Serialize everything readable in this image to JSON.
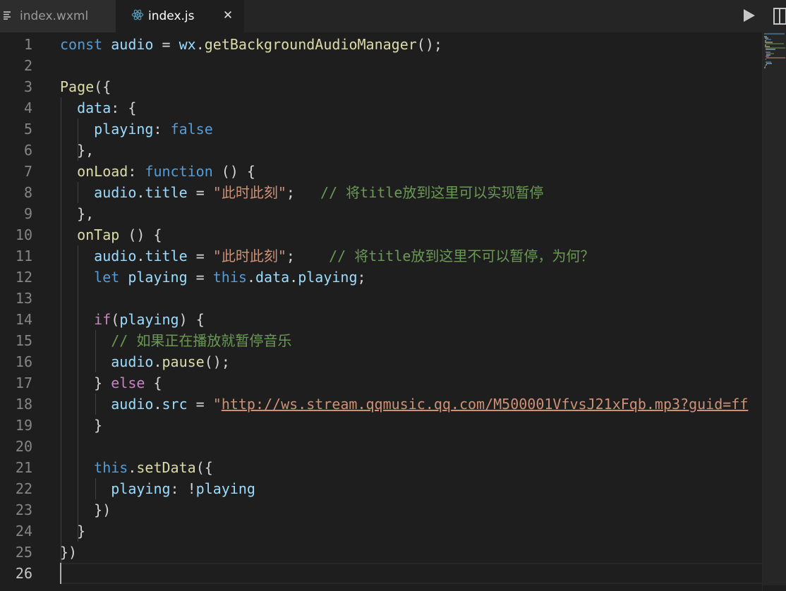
{
  "tabs": [
    {
      "label": "index.wxml",
      "icon": "file-lines-icon",
      "active": false
    },
    {
      "label": "index.js",
      "icon": "react-atom-icon",
      "active": true,
      "close": "✕"
    }
  ],
  "toolbar": {
    "run_icon": "play-icon",
    "split_icon": "split-editor-icon"
  },
  "editor": {
    "current_line": 26,
    "lines": [
      {
        "n": "1",
        "t": [
          [
            "kw",
            "const"
          ],
          [
            "pn",
            " "
          ],
          [
            "var",
            "audio"
          ],
          [
            "pn",
            " = "
          ],
          [
            "var",
            "wx"
          ],
          [
            "pn",
            "."
          ],
          [
            "fn",
            "getBackgroundAudioManager"
          ],
          [
            "pn",
            "();"
          ]
        ]
      },
      {
        "n": "2",
        "t": []
      },
      {
        "n": "3",
        "t": [
          [
            "fn",
            "Page"
          ],
          [
            "pn",
            "({"
          ]
        ]
      },
      {
        "n": "4",
        "t": [
          [
            "pn",
            "  "
          ],
          [
            "var",
            "data"
          ],
          [
            "pn",
            ": {"
          ]
        ]
      },
      {
        "n": "5",
        "t": [
          [
            "pn",
            "    "
          ],
          [
            "var",
            "playing"
          ],
          [
            "pn",
            ": "
          ],
          [
            "kw",
            "false"
          ]
        ]
      },
      {
        "n": "6",
        "t": [
          [
            "pn",
            "  },"
          ]
        ]
      },
      {
        "n": "7",
        "t": [
          [
            "pn",
            "  "
          ],
          [
            "fn",
            "onLoad"
          ],
          [
            "pn",
            ": "
          ],
          [
            "kw",
            "function"
          ],
          [
            "pn",
            " () {"
          ]
        ]
      },
      {
        "n": "8",
        "t": [
          [
            "pn",
            "    "
          ],
          [
            "var",
            "audio"
          ],
          [
            "pn",
            "."
          ],
          [
            "var",
            "title"
          ],
          [
            "pn",
            " = "
          ],
          [
            "str",
            "\"此时此刻\""
          ],
          [
            "pn",
            ";   "
          ],
          [
            "cmt",
            "// 将title放到这里可以实现暂停"
          ]
        ]
      },
      {
        "n": "9",
        "t": [
          [
            "pn",
            "  },"
          ]
        ]
      },
      {
        "n": "10",
        "t": [
          [
            "pn",
            "  "
          ],
          [
            "fn",
            "onTap"
          ],
          [
            "pn",
            " () {"
          ]
        ]
      },
      {
        "n": "11",
        "t": [
          [
            "pn",
            "    "
          ],
          [
            "var",
            "audio"
          ],
          [
            "pn",
            "."
          ],
          [
            "var",
            "title"
          ],
          [
            "pn",
            " = "
          ],
          [
            "str",
            "\"此时此刻\""
          ],
          [
            "pn",
            ";    "
          ],
          [
            "cmt",
            "// 将title放到这里不可以暂停，为何？"
          ]
        ]
      },
      {
        "n": "12",
        "t": [
          [
            "pn",
            "    "
          ],
          [
            "kw",
            "let"
          ],
          [
            "pn",
            " "
          ],
          [
            "var",
            "playing"
          ],
          [
            "pn",
            " = "
          ],
          [
            "kw",
            "this"
          ],
          [
            "pn",
            "."
          ],
          [
            "var",
            "data"
          ],
          [
            "pn",
            "."
          ],
          [
            "var",
            "playing"
          ],
          [
            "pn",
            ";"
          ]
        ]
      },
      {
        "n": "13",
        "t": []
      },
      {
        "n": "14",
        "t": [
          [
            "pn",
            "    "
          ],
          [
            "ctl",
            "if"
          ],
          [
            "pn",
            "("
          ],
          [
            "var",
            "playing"
          ],
          [
            "pn",
            ") {"
          ]
        ]
      },
      {
        "n": "15",
        "t": [
          [
            "pn",
            "      "
          ],
          [
            "cmt",
            "// 如果正在播放就暂停音乐"
          ]
        ]
      },
      {
        "n": "16",
        "t": [
          [
            "pn",
            "      "
          ],
          [
            "var",
            "audio"
          ],
          [
            "pn",
            "."
          ],
          [
            "fn",
            "pause"
          ],
          [
            "pn",
            "();"
          ]
        ]
      },
      {
        "n": "17",
        "t": [
          [
            "pn",
            "    } "
          ],
          [
            "ctl",
            "else"
          ],
          [
            "pn",
            " {"
          ]
        ]
      },
      {
        "n": "18",
        "t": [
          [
            "pn",
            "      "
          ],
          [
            "var",
            "audio"
          ],
          [
            "pn",
            "."
          ],
          [
            "var",
            "src"
          ],
          [
            "pn",
            " = "
          ],
          [
            "str",
            "\""
          ],
          [
            "url",
            "http://ws.stream.qqmusic.qq.com/M500001VfvsJ21xFqb.mp3?guid=ff"
          ]
        ]
      },
      {
        "n": "19",
        "t": [
          [
            "pn",
            "    }"
          ]
        ]
      },
      {
        "n": "20",
        "t": []
      },
      {
        "n": "21",
        "t": [
          [
            "pn",
            "    "
          ],
          [
            "kw",
            "this"
          ],
          [
            "pn",
            "."
          ],
          [
            "fn",
            "setData"
          ],
          [
            "pn",
            "({"
          ]
        ]
      },
      {
        "n": "22",
        "t": [
          [
            "pn",
            "      "
          ],
          [
            "var",
            "playing"
          ],
          [
            "pn",
            ": !"
          ],
          [
            "var",
            "playing"
          ]
        ]
      },
      {
        "n": "23",
        "t": [
          [
            "pn",
            "    })"
          ]
        ]
      },
      {
        "n": "24",
        "t": [
          [
            "pn",
            "  }"
          ]
        ]
      },
      {
        "n": "25",
        "t": [
          [
            "pn",
            "})"
          ]
        ]
      },
      {
        "n": "26",
        "t": []
      }
    ]
  }
}
